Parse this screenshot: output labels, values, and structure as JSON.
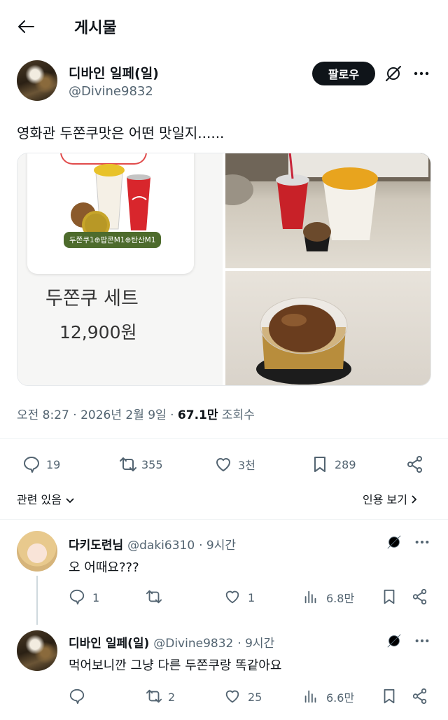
{
  "header": {
    "title": "게시물"
  },
  "post": {
    "author_name": "디바인 일페(일)",
    "handle": "@Divine9832",
    "follow_label": "팔로우",
    "text": "영화관 두쫀쿠맛은 어떤 맛일지......",
    "media": {
      "menu_badge": "두쫀쿠1⊕팝콘M1⊕탄산M1",
      "set_name": "두쫀쿠 세트",
      "price": "12,900원"
    },
    "meta": {
      "time": "오전 8:27",
      "date": "2026년 2월 9일",
      "views": "67.1만",
      "views_label": "조회수"
    },
    "stats": {
      "replies": "19",
      "reposts": "355",
      "likes": "3천",
      "bookmarks": "289"
    },
    "related_label": "관련 있음",
    "quotes_label": "인용 보기"
  },
  "replies": [
    {
      "name": "다키도련님",
      "handle": "@daki6310",
      "time": "9시간",
      "text": "오 어때요???",
      "replies": "1",
      "reposts": "",
      "likes": "1",
      "views": "6.8만"
    },
    {
      "name": "디바인 일페(일)",
      "handle": "@Divine9832",
      "time": "9시간",
      "text": "먹어보니깐 그냥 다른 두쫀쿠랑 똑같아요",
      "replies": "",
      "reposts": "2",
      "likes": "25",
      "views": "6.6만"
    }
  ]
}
